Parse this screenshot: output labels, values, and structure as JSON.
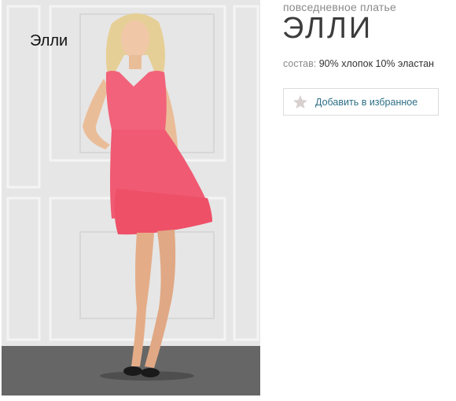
{
  "product": {
    "photo_caption": "Элли",
    "subtitle": "повседневное платье",
    "title": "ЭЛЛИ",
    "composition_label": "состав:",
    "composition_value": "90% хлопок 10% эластан",
    "favorite_label": "Добавить в избранное",
    "favorite_icon": "star-icon"
  },
  "colors": {
    "dress": "#f2627a",
    "favorite_text": "#2e6f86",
    "star": "#d8cfcf"
  }
}
